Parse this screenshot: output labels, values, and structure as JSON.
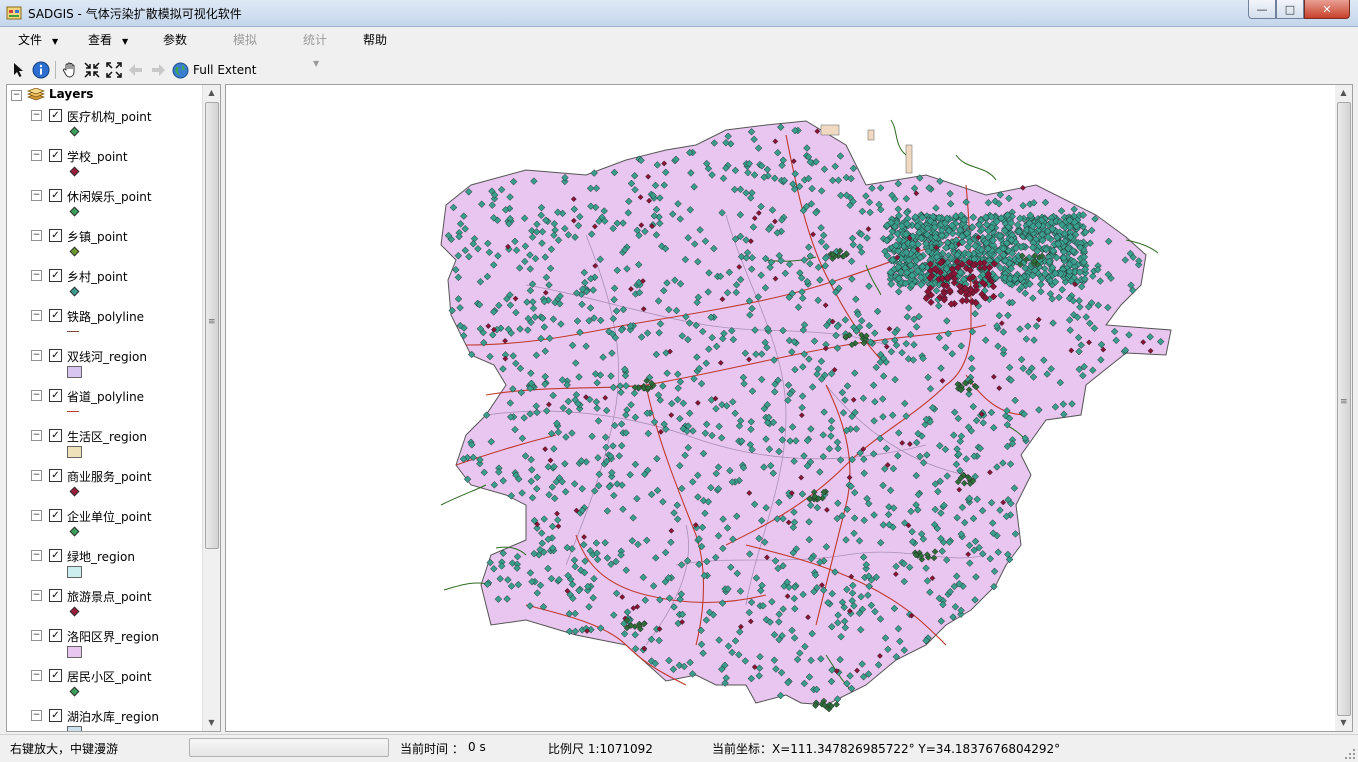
{
  "window": {
    "title": "SADGIS - 气体污染扩散模拟可视化软件",
    "buttons": {
      "minimize": "—",
      "maximize": "□",
      "close": "✕"
    }
  },
  "menu": {
    "items": [
      {
        "label": "文件",
        "dropdown": true,
        "enabled": true
      },
      {
        "label": "查看",
        "dropdown": true,
        "enabled": true
      },
      {
        "label": "参数",
        "dropdown": false,
        "enabled": true
      },
      {
        "label": "模拟",
        "dropdown": false,
        "enabled": false
      },
      {
        "label": "统计",
        "dropdown": true,
        "enabled": false
      },
      {
        "label": "帮助",
        "dropdown": false,
        "enabled": true
      }
    ]
  },
  "toolbar": {
    "icons": [
      "select-arrow-icon",
      "identify-info-icon",
      "pan-hand-icon",
      "zoom-in-icon",
      "zoom-out-icon",
      "back-arrow-icon",
      "forward-arrow-icon",
      "globe-icon"
    ],
    "full_extent_label": "Full Extent"
  },
  "toc": {
    "root_label": "Layers",
    "layers": [
      {
        "name": "医疗机构_point",
        "checked": true,
        "symbol": "point",
        "color": "#3aa05a"
      },
      {
        "name": "学校_point",
        "checked": true,
        "symbol": "point",
        "color": "#9b1a3c"
      },
      {
        "name": "休闲娱乐_point",
        "checked": true,
        "symbol": "point",
        "color": "#3aa05a"
      },
      {
        "name": "乡镇_point",
        "checked": true,
        "symbol": "point",
        "color": "#6a9a2a"
      },
      {
        "name": "乡村_point",
        "checked": true,
        "symbol": "point",
        "color": "#3a9e8e"
      },
      {
        "name": "铁路_polyline",
        "checked": true,
        "symbol": "line",
        "color": "#7a4a3a"
      },
      {
        "name": "双线河_region",
        "checked": true,
        "symbol": "fill",
        "color": "#d8c6f0"
      },
      {
        "name": "省道_polyline",
        "checked": true,
        "symbol": "line",
        "color": "#c0392b"
      },
      {
        "name": "生活区_region",
        "checked": true,
        "symbol": "fill",
        "color": "#f0e2b8"
      },
      {
        "name": "商业服务_point",
        "checked": true,
        "symbol": "point",
        "color": "#9b1a3c"
      },
      {
        "name": "企业单位_point",
        "checked": true,
        "symbol": "point",
        "color": "#3aa05a"
      },
      {
        "name": "绿地_region",
        "checked": true,
        "symbol": "fill",
        "color": "#cdeeee"
      },
      {
        "name": "旅游景点_point",
        "checked": true,
        "symbol": "point",
        "color": "#9b1a3c"
      },
      {
        "name": "洛阳区界_region",
        "checked": true,
        "symbol": "fill",
        "color": "#e8c6f0"
      },
      {
        "name": "居民小区_point",
        "checked": true,
        "symbol": "point",
        "color": "#3aa05a"
      },
      {
        "name": "湖泊水库_region",
        "checked": true,
        "symbol": "fill",
        "color": "#cde0ee"
      }
    ]
  },
  "map": {
    "region_fill": "#e8c6f0",
    "point_color": "#3a9e8e",
    "road_color": "#c0392b",
    "river_color": "#2e6b1f"
  },
  "status": {
    "hint": "右键放大，中键漫游",
    "time_label": "当前时间 ：",
    "time_value": "0 s",
    "scale_label": "比例尺 1:1071092",
    "coord_label": "当前坐标：X=111.347826985722°  Y=34.1837676804292°"
  }
}
